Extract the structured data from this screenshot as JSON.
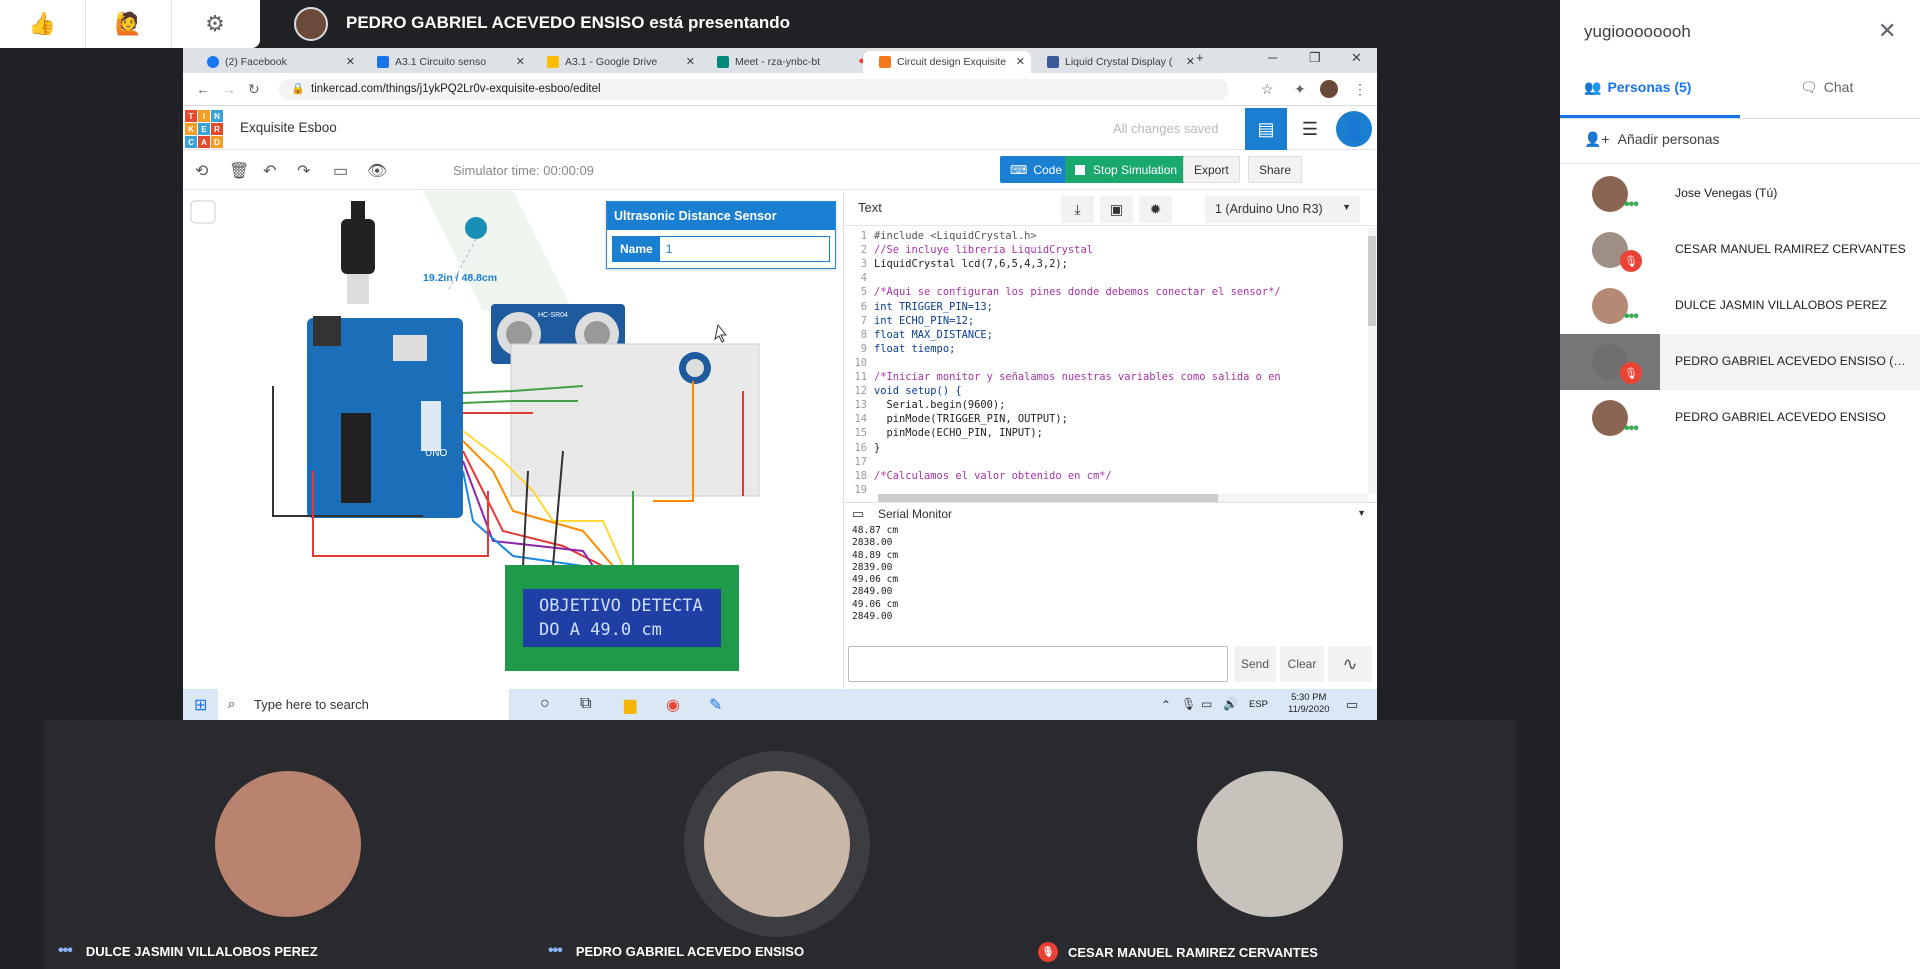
{
  "meet": {
    "presenting_text": "PEDRO GABRIEL ACEVEDO ENSISO está presentando",
    "quick_actions": [
      "thumbs-up-icon",
      "raise-hand-icon",
      "gear-icon"
    ]
  },
  "browser": {
    "tabs": [
      {
        "label": "(2) Facebook",
        "color": "#1877f2"
      },
      {
        "label": "A3.1 Circuito senso",
        "color": "#1a73e8"
      },
      {
        "label": "A3.1 - Google Drive",
        "color": "#fbbc04"
      },
      {
        "label": "Meet - rza-ynbc-bt",
        "color": "#00897b"
      },
      {
        "label": "Circuit design Exquisite",
        "color": "#f47a20"
      },
      {
        "label": "Liquid Crystal Display (",
        "color": "#3b5998"
      }
    ],
    "url": "tinkercad.com/things/j1ykPQ2Lr0v-exquisite-esboo/editel"
  },
  "tinkercad": {
    "logo_letters": [
      "T",
      "I",
      "N",
      "K",
      "E",
      "R",
      "C",
      "A",
      "D"
    ],
    "logo_colors": [
      "#e54a2e",
      "#f49d24",
      "#3ba2d8",
      "#e54a2e",
      "#f49d24",
      "#3ba2d8",
      "#e54a2e",
      "#f49d24",
      "#3ba2d8"
    ],
    "project_name": "Exquisite Esboo",
    "saved_status": "All changes saved",
    "simulator_time": "Simulator time: 00:00:09",
    "code_button": "Code",
    "stop_button": "Stop Simulation",
    "export_button": "Export",
    "share_button": "Share",
    "sensor_panel": {
      "title": "Ultrasonic Distance Sensor",
      "name_label": "Name",
      "name_value": "1"
    },
    "distance_label": "19.2in / 48.8cm",
    "sensor_model": "HC-SR04",
    "lcd_line1": "OBJETIVO DETECTA",
    "lcd_line2": "DO A  49.0 cm",
    "code_mode": "Text",
    "board": "1 (Arduino Uno R3)",
    "code_lines": [
      "#include <LiquidCrystal.h>",
      "//Se incluye libreria LiquidCrystal",
      "LiquidCrystal lcd(7,6,5,4,3,2);",
      "",
      "/*Aqui se configuran los pines donde debemos conectar el sensor*/",
      "int TRIGGER_PIN=13;",
      "int ECHO_PIN=12;",
      "float MAX_DISTANCE;",
      "float tiempo;",
      "",
      "/*Iniciar monitor y señalamos nuestras variables como salida o en",
      "void setup() {",
      "  Serial.begin(9600);",
      "  pinMode(TRIGGER_PIN, OUTPUT);",
      "  pinMode(ECHO_PIN, INPUT);",
      "}",
      "",
      "/*Calculamos el valor obtenido en cm*/",
      ""
    ],
    "serial_monitor_title": "Serial Monitor",
    "serial_output": [
      "48.87 cm",
      "2838.00",
      "48.89 cm",
      "2839.00",
      "49.06 cm",
      "2849.00",
      "49.06 cm",
      "2849.00"
    ],
    "send_button": "Send",
    "clear_button": "Clear"
  },
  "taskbar": {
    "search_placeholder": "Type here to search",
    "lang": "ESP",
    "time": "5:30 PM",
    "date": "11/9/2020"
  },
  "people_panel": {
    "title": "yugioooooooh",
    "tab_people": "Personas (5)",
    "tab_chat": "Chat",
    "add_people": "Añadir personas",
    "participants": [
      {
        "name": "Jose Venegas (Tú)",
        "status": "speaking"
      },
      {
        "name": "CESAR MANUEL RAMIREZ CERVANTES",
        "status": "muted"
      },
      {
        "name": "DULCE JASMIN VILLALOBOS PEREZ",
        "status": "speaking"
      },
      {
        "name": "PEDRO GABRIEL ACEVEDO ENSISO (presentación)",
        "status": "muted"
      },
      {
        "name": "PEDRO GABRIEL ACEVEDO ENSISO",
        "status": "speaking"
      }
    ]
  },
  "video_tiles": [
    {
      "name": "DULCE JASMIN VILLALOBOS PEREZ",
      "status": "speaking"
    },
    {
      "name": "PEDRO GABRIEL ACEVEDO ENSISO",
      "status": "speaking"
    },
    {
      "name": "CESAR MANUEL RAMIREZ CERVANTES",
      "status": "muted"
    }
  ]
}
